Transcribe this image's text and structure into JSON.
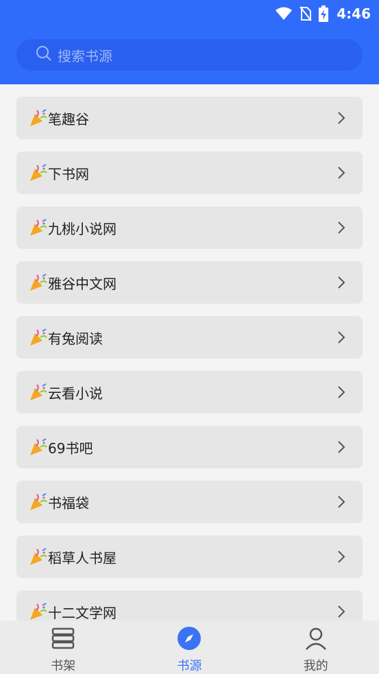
{
  "status_bar": {
    "time": "4:46"
  },
  "search": {
    "placeholder": "搜索书源"
  },
  "sources": [
    {
      "label": "笔趣谷"
    },
    {
      "label": "下书网"
    },
    {
      "label": "九桃小说网"
    },
    {
      "label": "雅谷中文网"
    },
    {
      "label": "有兔阅读"
    },
    {
      "label": "云看小说"
    },
    {
      "label": "69书吧"
    },
    {
      "label": "书福袋"
    },
    {
      "label": "稻草人书屋"
    },
    {
      "label": "十二文学网"
    }
  ],
  "bottom_nav": [
    {
      "label": "书架",
      "icon": "bookshelf-icon"
    },
    {
      "label": "书源",
      "icon": "compass-icon",
      "active": true
    },
    {
      "label": "我的",
      "icon": "person-icon"
    }
  ],
  "colors": {
    "accent": "#2f6cfb",
    "active_tab": "#3b73f5"
  }
}
